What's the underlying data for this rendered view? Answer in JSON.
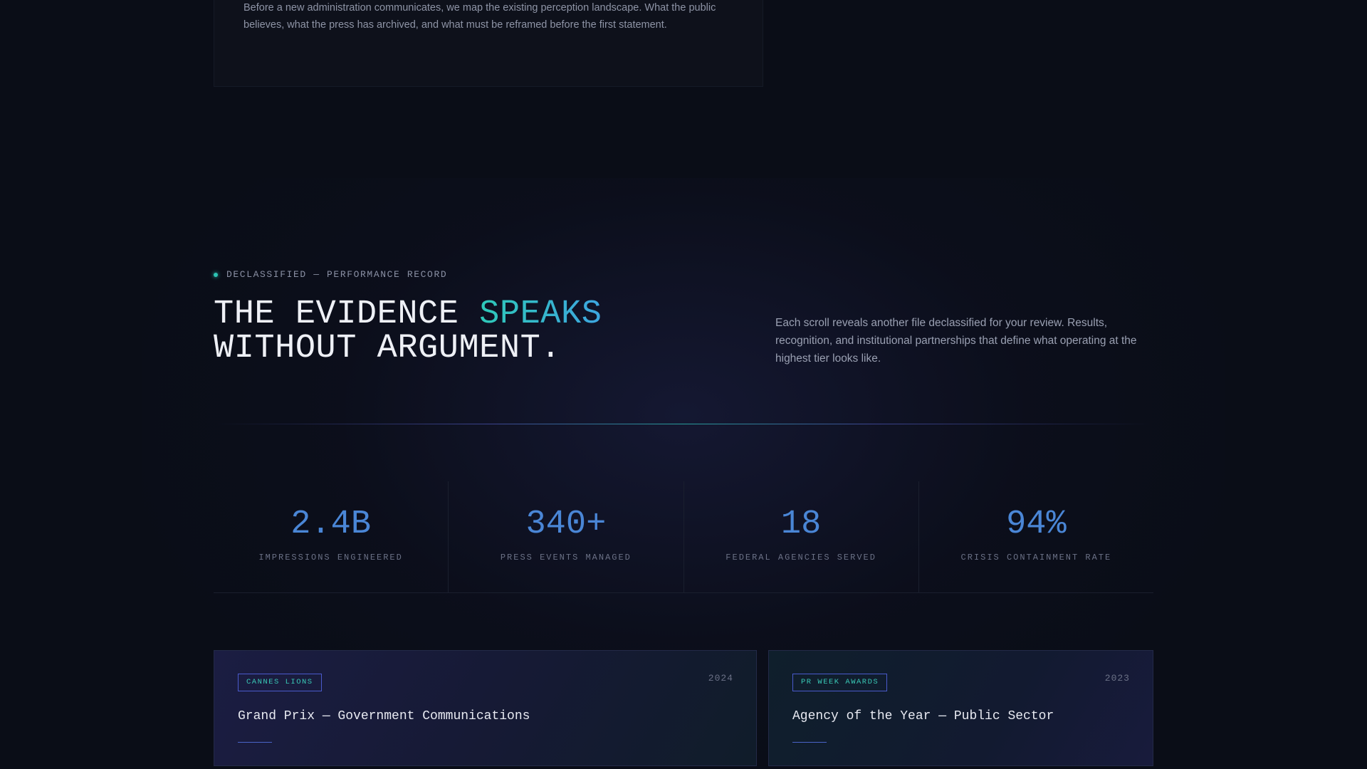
{
  "top_card": {
    "text": "Before a new administration communicates, we map the existing perception landscape. What the public believes, what the press has archived, and what must be reframed before the first statement."
  },
  "section": {
    "eyebrow": "DECLASSIFIED — PERFORMANCE RECORD",
    "headline_part1": "THE EVIDENCE ",
    "headline_accent": "SPEAKS",
    "headline_part2": "WITHOUT ARGUMENT.",
    "intro": "Each scroll reveals another file declassified for your review. Results, recognition, and institutional partnerships that define what operating at the highest tier looks like."
  },
  "stats": [
    {
      "value": "2.4B",
      "label": "IMPRESSIONS ENGINEERED"
    },
    {
      "value": "340+",
      "label": "PRESS EVENTS MANAGED"
    },
    {
      "value": "18",
      "label": "FEDERAL AGENCIES SERVED"
    },
    {
      "value": "94%",
      "label": "CRISIS CONTAINMENT RATE"
    }
  ],
  "awards": [
    {
      "badge": "CANNES LIONS",
      "year": "2024",
      "title": "Grand Prix — Government Communications"
    },
    {
      "badge": "PR WEEK AWARDS",
      "year": "2023",
      "title": "Agency of the Year — Public Sector"
    }
  ],
  "colors": {
    "background": "#0a0d17",
    "accent_teal": "#2ec9b8",
    "accent_blue": "#4a86d6"
  }
}
